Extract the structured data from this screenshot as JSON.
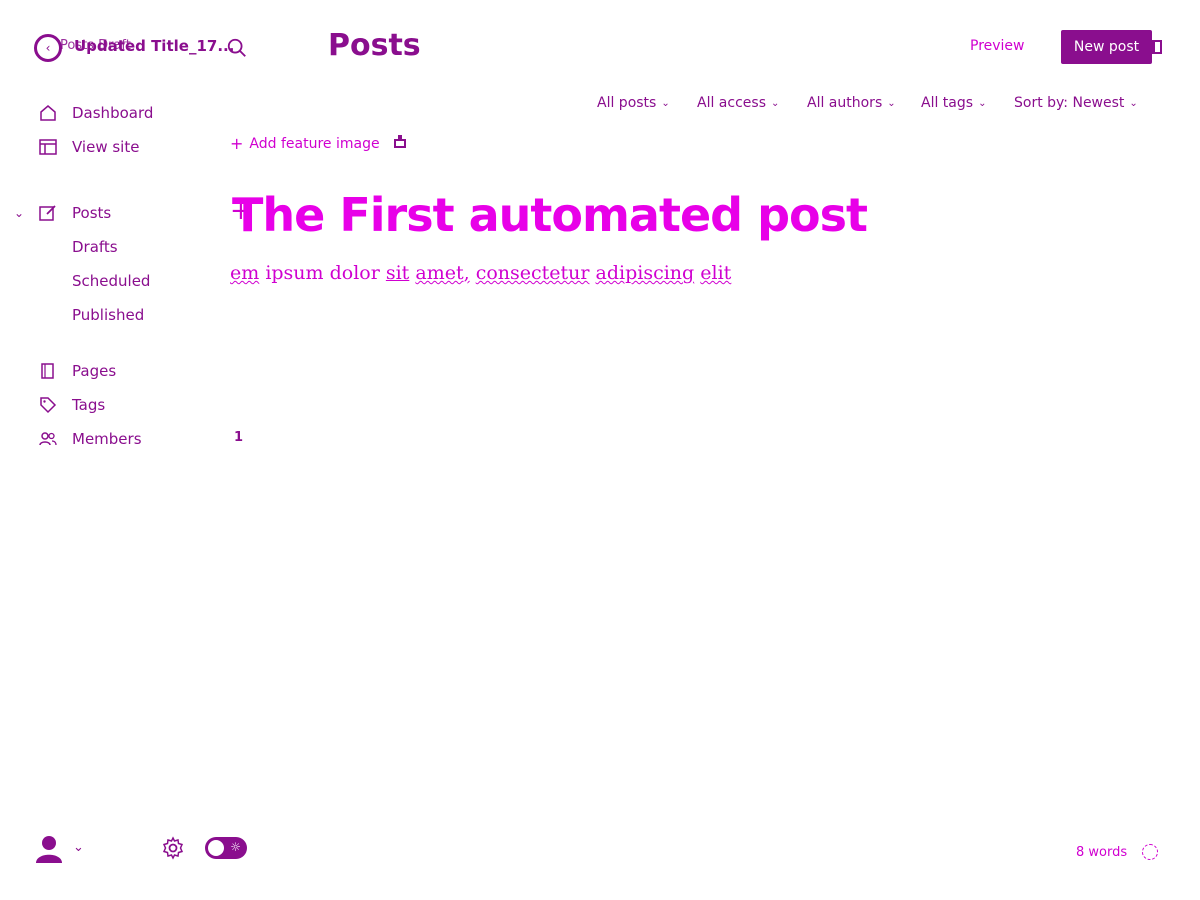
{
  "header": {
    "breadcrumb_ghost": "Posts Draft",
    "post_title_short": "Updated Title_17...",
    "page_title": "Posts",
    "preview_label": "Preview",
    "new_post_label": "New post"
  },
  "filters": [
    {
      "label": "All posts"
    },
    {
      "label": "All access"
    },
    {
      "label": "All authors"
    },
    {
      "label": "All tags"
    },
    {
      "label": "Sort by: Newest"
    }
  ],
  "sidebar": {
    "items": [
      {
        "label": "Dashboard",
        "icon": "home-icon"
      },
      {
        "label": "View site",
        "icon": "layout-icon"
      },
      {
        "label": "Posts",
        "icon": "edit-icon"
      },
      {
        "label": "Pages",
        "icon": "page-icon"
      },
      {
        "label": "Tags",
        "icon": "tag-icon"
      },
      {
        "label": "Members",
        "icon": "users-icon"
      }
    ],
    "post_subitems": [
      {
        "label": "Drafts"
      },
      {
        "label": "Scheduled"
      },
      {
        "label": "Published"
      }
    ]
  },
  "editor": {
    "add_feature_image": "Add feature image",
    "post_title": "The First automated post",
    "body_words": [
      "em",
      "ipsum",
      "dolor",
      "sit",
      "amet,",
      "consectetur",
      "adipiscing",
      "elit"
    ],
    "count_label": "1",
    "word_count": "8 words"
  },
  "colors": {
    "accent_dark": "#8a0e8e",
    "accent_bright": "#e800e8"
  }
}
